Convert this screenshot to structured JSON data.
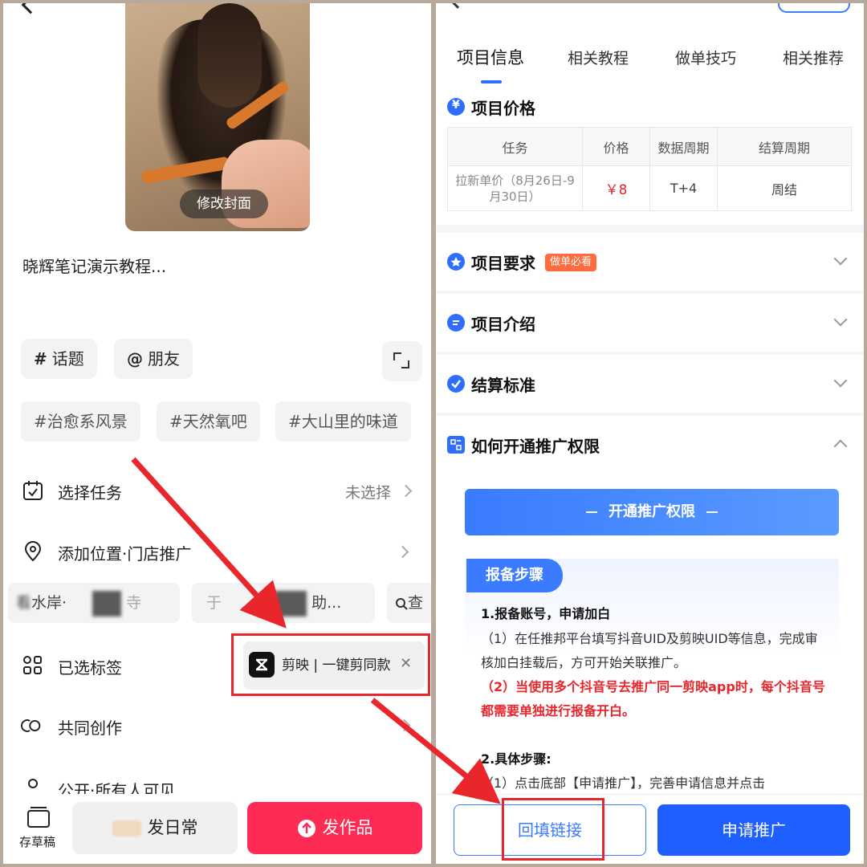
{
  "left": {
    "cover_button": "修改封面",
    "description": "晓辉笔记演示教程...",
    "chips": {
      "topic": "话题",
      "friend": "朋友",
      "topic_symbol": "#",
      "friend_symbol": "@"
    },
    "tags": [
      "#治愈系风景",
      "#天然氧吧",
      "#大山里的味道"
    ],
    "rows": {
      "task": {
        "label": "选择任务",
        "value": "未选择"
      },
      "location": {
        "label": "添加位置·门店推广"
      },
      "loc_chips": [
        "看",
        "水岸",
        "寺",
        "于",
        "助..."
      ],
      "loc_search": "查",
      "selected_tags": {
        "label": "已选标签",
        "tag": "剪映 | 一键剪同款",
        "close": "✕"
      },
      "co_create": {
        "label": "共同创作"
      },
      "visibility": {
        "label": "公开·所有人可见"
      }
    },
    "bottom": {
      "draft": "存草稿",
      "daily": "发日常",
      "publish": "发作品"
    }
  },
  "right": {
    "tabs": [
      "项目信息",
      "相关教程",
      "做单技巧",
      "相关推荐"
    ],
    "price_section": {
      "title": "项目价格",
      "headers": [
        "任务",
        "价格",
        "数据周期",
        "结算周期"
      ],
      "row": [
        "拉新单价（8月26日-9月30日）",
        "￥8",
        "T+4",
        "周结"
      ]
    },
    "sections": {
      "requirements": "项目要求",
      "requirements_badge": "做单必看",
      "intro": "项目介绍",
      "settlement": "结算标准",
      "howto": "如何开通推广权限"
    },
    "open_button": "开通推广权限",
    "steps": {
      "badge": "报备步骤",
      "h1": "1.报备账号，申请加白",
      "p1": "（1）在任推邦平台填写抖音UID及剪映UID等信息，完成审核加白挂载后，方可开始关联推广。",
      "p2": "（2）当使用多个抖音号去推广同一剪映app时，每个抖音号都需要单独进行报备开白。",
      "h2": "2.具体步骤:",
      "p3": "（1）点击底部【申请推广】，完善申请信息并点击"
    },
    "bottom": {
      "backfill": "回填链接",
      "apply": "申请推广"
    }
  },
  "colors": {
    "accent_blue": "#2f6dff",
    "publish_red": "#fe2c55",
    "annotation_red": "#e8262c",
    "price_red": "#e8262c"
  }
}
